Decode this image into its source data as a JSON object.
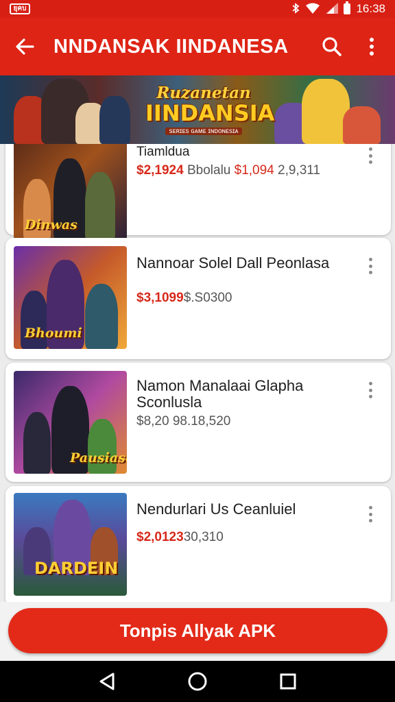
{
  "status_bar": {
    "notification_label": "ยุคบ",
    "time": "16:38",
    "icons": [
      "bluetooth-icon",
      "wifi-icon",
      "signal-icon",
      "battery-icon"
    ]
  },
  "app_bar": {
    "title": "NNDANSAK IINDANESA",
    "icons": [
      "back-arrow-icon",
      "search-icon",
      "more-vert-icon"
    ]
  },
  "banner": {
    "logo_line1": "Ruzanetan",
    "logo_line2": "IINDANSIA",
    "logo_line3": "ꜱᴇʀɪᴇs ɢᴀᴍᴇ ɪɴᴅᴏɴᴇsɪᴀ"
  },
  "items": [
    {
      "name": "Tiamldua",
      "price_red_1": "$2,1924",
      "price_gray_1": "Bbolalu",
      "price_red_2": "$1,094",
      "price_gray_2": "2,9,311",
      "thumb_badge": "Dinwas",
      "icon": "game-thumbnail"
    },
    {
      "name": "Nannoar Solel Dall Peonlasa",
      "price_red_1": "$3,1099",
      "price_gray_1": "$.S0300",
      "thumb_badge": "Bhoumi",
      "icon": "game-thumbnail"
    },
    {
      "name": "Namon Manalaai Glapha Sconlusla",
      "price_gray_1": "$8,20 98.18,520",
      "thumb_badge": "Pausiaso",
      "icon": "game-thumbnail"
    },
    {
      "name": "Nendurlari Us Ceanluiel",
      "price_red_1": "$2,0123",
      "price_gray_1": "30,310",
      "thumb_badge": "DARDEIN",
      "icon": "game-thumbnail"
    }
  ],
  "cta_button": {
    "label": "Tonpis Allyak APK"
  },
  "nav_bar": {
    "icons": [
      "back-triangle-icon",
      "home-circle-icon",
      "recents-square-icon"
    ]
  },
  "colors": {
    "primary_red": "#de2415",
    "price_red": "#d6281a",
    "button_red": "#e32a19"
  }
}
